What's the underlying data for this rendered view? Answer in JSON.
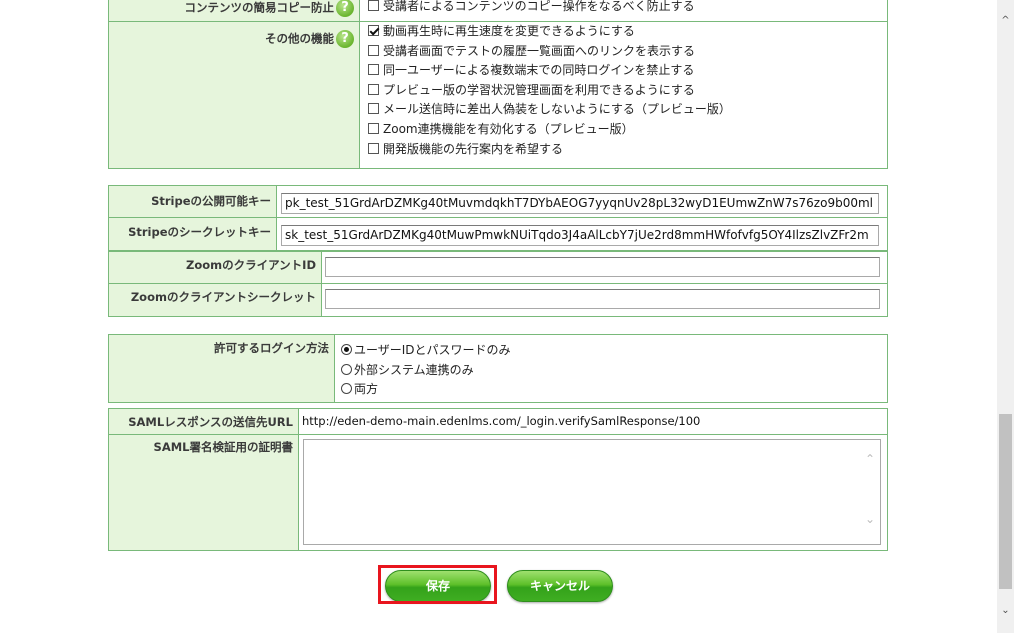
{
  "top_section": {
    "copy_prevent_label": "コンテンツの簡易コピー防止",
    "copy_prevent_option": "受講者によるコンテンツのコピー操作をなるべく防止する",
    "other_features_label": "その他の機能",
    "help_glyph": "?",
    "other_features": [
      {
        "label": "動画再生時に再生速度を変更できるようにする",
        "checked": true
      },
      {
        "label": "受講者画面でテストの履歴一覧画面へのリンクを表示する",
        "checked": false
      },
      {
        "label": "同一ユーザーによる複数端末での同時ログインを禁止する",
        "checked": false
      },
      {
        "label": "プレビュー版の学習状況管理画面を利用できるようにする",
        "checked": false
      },
      {
        "label": "メール送信時に差出人偽装をしないようにする（プレビュー版）",
        "checked": false
      },
      {
        "label": "Zoom連携機能を有効化する（プレビュー版）",
        "checked": false
      },
      {
        "label": "開発版機能の先行案内を希望する",
        "checked": false
      }
    ]
  },
  "keys_section": {
    "stripe_public_label": "Stripeの公開可能キー",
    "stripe_public_value": "pk_test_51GrdArDZMKg40tMuvmdqkhT7DYbAEOG7yyqnUv28pL32wyD1EUmwZnW7s76zo9b00ml",
    "stripe_secret_label": "Stripeのシークレットキー",
    "stripe_secret_value": "sk_test_51GrdArDZMKg40tMuwPmwkNUiTqdo3J4aAlLcbY7jUe2rd8mmHWfofvfg5OY4IlzsZlvZFr2m",
    "zoom_client_id_label": "ZoomのクライアントID",
    "zoom_client_id_value": "",
    "zoom_client_secret_label": "Zoomのクライアントシークレット",
    "zoom_client_secret_value": ""
  },
  "login_section": {
    "login_method_label": "許可するログイン方法",
    "login_methods": [
      {
        "label": "ユーザーIDとパスワードのみ",
        "selected": true
      },
      {
        "label": "外部システム連携のみ",
        "selected": false
      },
      {
        "label": "両方",
        "selected": false
      }
    ],
    "saml_url_label": "SAMLレスポンスの送信先URL",
    "saml_url_value": "http://eden-demo-main.edenlms.com/_login.verifySamlResponse/100",
    "saml_cert_label": "SAML署名検証用の証明書",
    "saml_cert_value": ""
  },
  "actions": {
    "save_label": "保存",
    "cancel_label": "キャンセル"
  },
  "colors": {
    "label_bg": "#e6f5dc",
    "border": "#79b97a",
    "button_green": "#4db324",
    "highlight_red": "#e8151e"
  }
}
